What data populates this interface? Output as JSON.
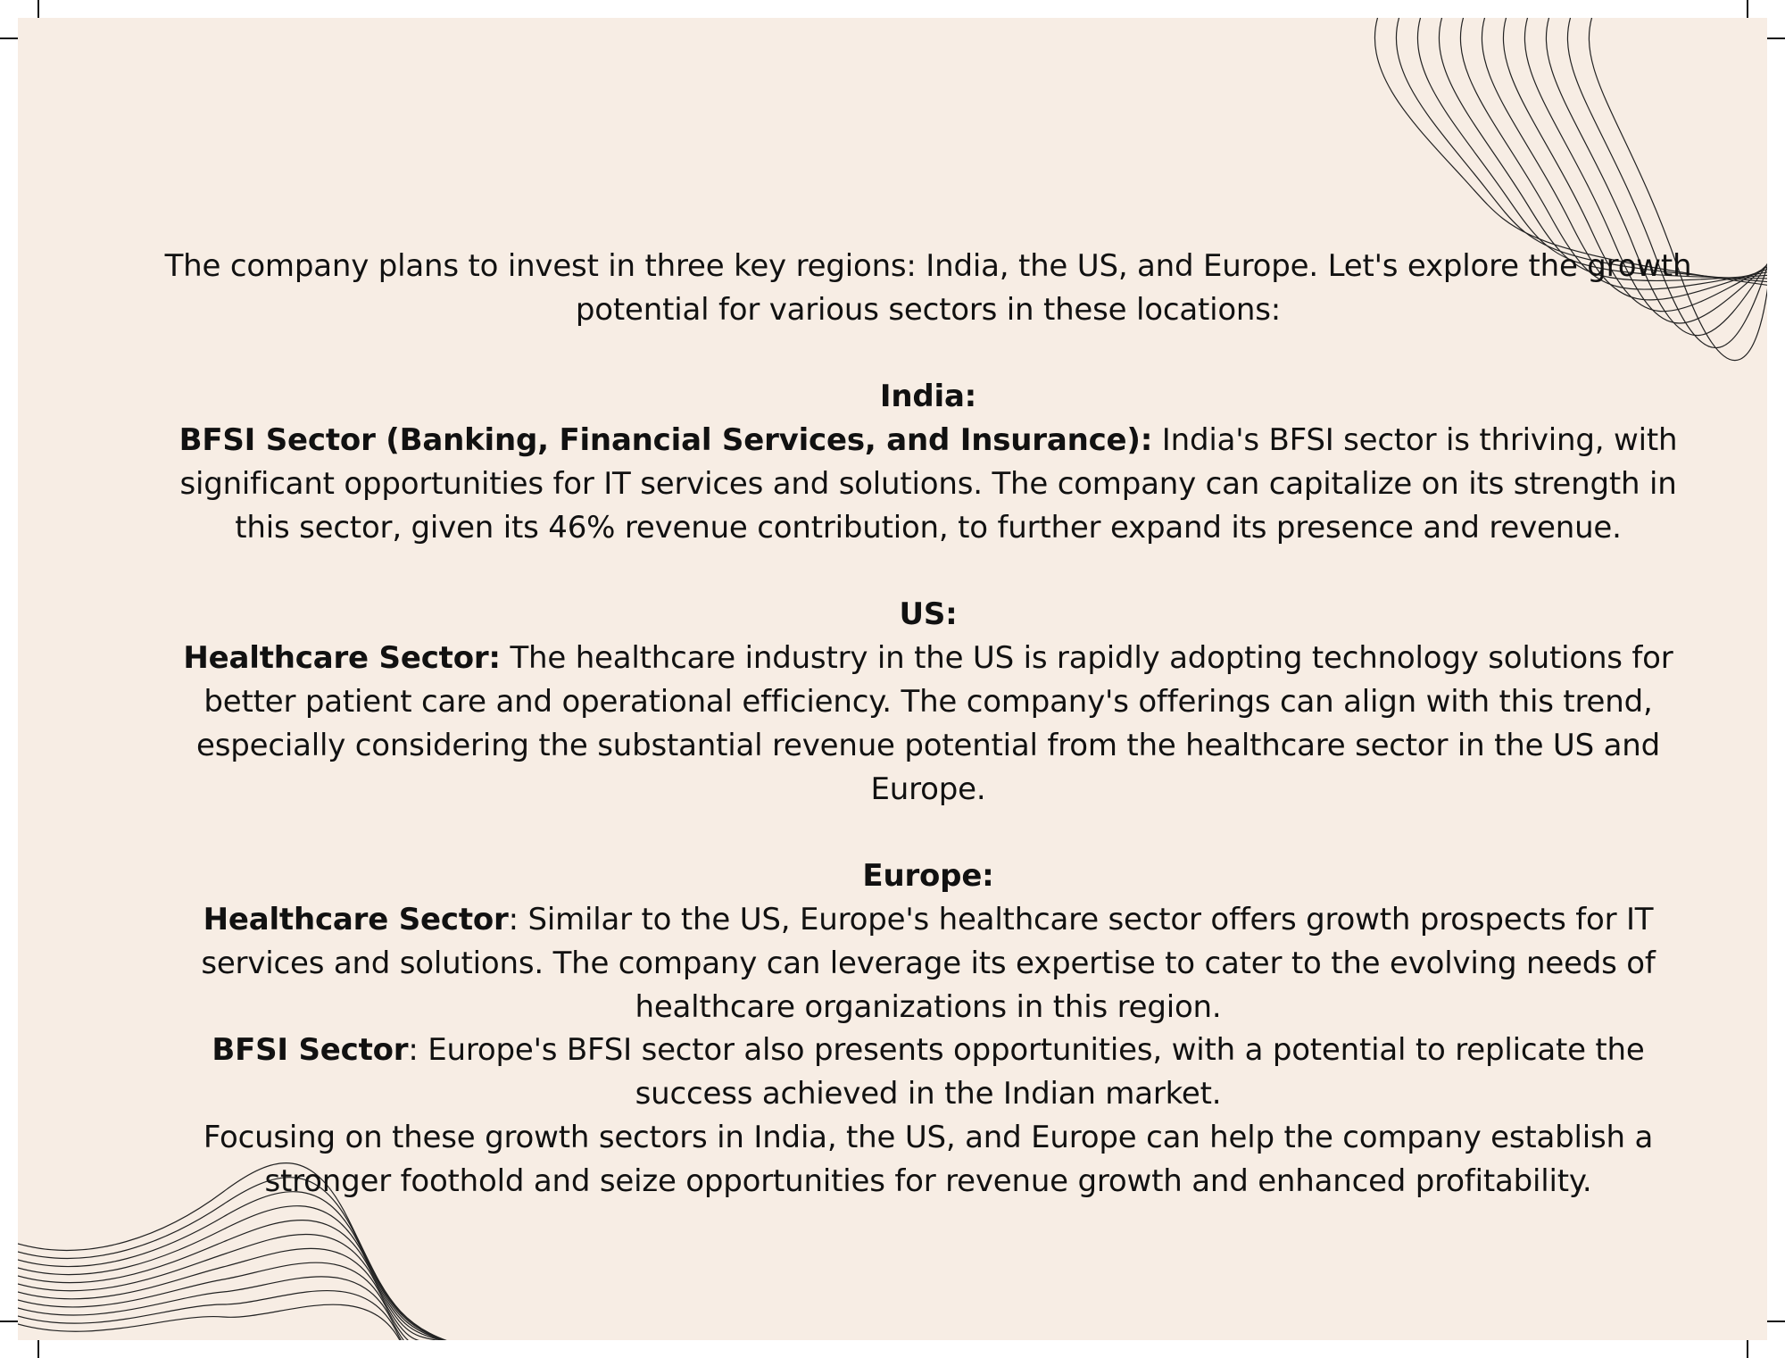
{
  "intro": "The company plans to invest in three key regions: India, the US, and Europe. Let's explore the growth potential for various sectors in these locations:",
  "sections": {
    "india": {
      "heading": "India:",
      "sector_label": "BFSI Sector (Banking, Financial Services, and Insurance):",
      "sector_text": " India's BFSI sector is thriving, with significant opportunities for IT services and solutions. The company can capitalize on its strength in this sector, given its 46% revenue contribution, to further expand its presence and revenue."
    },
    "us": {
      "heading": "US:",
      "sector_label": "Healthcare Sector:",
      "sector_text": " The healthcare industry in the US is rapidly adopting technology solutions for better patient care and operational efficiency. The company's offerings can align with this trend, especially considering the substantial revenue potential from the healthcare sector in the US and Europe."
    },
    "europe": {
      "heading": "Europe:",
      "healthcare_label": "Healthcare Sector",
      "healthcare_text": ": Similar to the US, Europe's healthcare sector offers growth prospects for IT services and solutions. The company can leverage its expertise to cater to the evolving needs of healthcare organizations in this region.",
      "bfsi_label": "BFSI Sector",
      "bfsi_text": ": Europe's BFSI sector also presents opportunities, with a potential to replicate the success achieved in the Indian market."
    }
  },
  "conclusion": "Focusing on these growth sectors in India, the US, and Europe can help the company establish a stronger foothold and seize opportunities for revenue growth and enhanced profitability.",
  "colors": {
    "page_background": "#f7ede4",
    "text": "#111111",
    "wave_lines": "#222222"
  }
}
